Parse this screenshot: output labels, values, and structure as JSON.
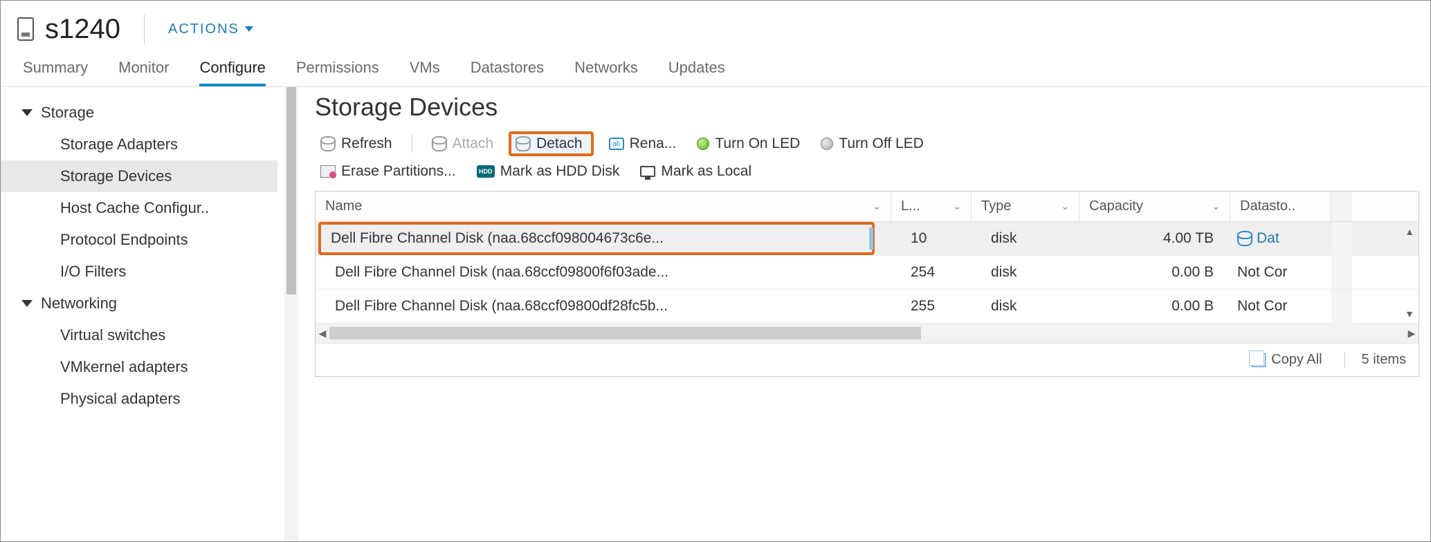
{
  "header": {
    "host_name": "s1240",
    "actions_label": "ACTIONS"
  },
  "tabs": [
    {
      "label": "Summary",
      "active": false
    },
    {
      "label": "Monitor",
      "active": false
    },
    {
      "label": "Configure",
      "active": true
    },
    {
      "label": "Permissions",
      "active": false
    },
    {
      "label": "VMs",
      "active": false
    },
    {
      "label": "Datastores",
      "active": false
    },
    {
      "label": "Networks",
      "active": false
    },
    {
      "label": "Updates",
      "active": false
    }
  ],
  "sidebar": {
    "groups": [
      {
        "label": "Storage",
        "children": [
          {
            "label": "Storage Adapters",
            "selected": false
          },
          {
            "label": "Storage Devices",
            "selected": true
          },
          {
            "label": "Host Cache Configur..",
            "selected": false
          },
          {
            "label": "Protocol Endpoints",
            "selected": false
          },
          {
            "label": "I/O Filters",
            "selected": false
          }
        ]
      },
      {
        "label": "Networking",
        "children": [
          {
            "label": "Virtual switches",
            "selected": false
          },
          {
            "label": "VMkernel adapters",
            "selected": false
          },
          {
            "label": "Physical adapters",
            "selected": false
          }
        ]
      }
    ]
  },
  "panel": {
    "title": "Storage Devices",
    "toolbar": {
      "refresh": "Refresh",
      "attach": "Attach",
      "detach": "Detach",
      "rename": "Rena...",
      "turn_on_led": "Turn On LED",
      "turn_off_led": "Turn Off LED",
      "erase": "Erase Partitions...",
      "mark_hdd": "Mark as HDD Disk",
      "mark_local": "Mark as Local"
    },
    "columns": {
      "name": "Name",
      "l": "L...",
      "type": "Type",
      "capacity": "Capacity",
      "datastore": "Datasto.."
    },
    "rows": [
      {
        "name": "Dell Fibre Channel Disk (naa.68ccf098004673c6e...",
        "l": "10",
        "type": "disk",
        "capacity": "4.00 TB",
        "datastore": "Dat",
        "selected": true,
        "ds_link": true
      },
      {
        "name": "Dell Fibre Channel Disk (naa.68ccf09800f6f03ade...",
        "l": "254",
        "type": "disk",
        "capacity": "0.00 B",
        "datastore": "Not Cor",
        "selected": false,
        "ds_link": false
      },
      {
        "name": "Dell Fibre Channel Disk (naa.68ccf09800df28fc5b...",
        "l": "255",
        "type": "disk",
        "capacity": "0.00 B",
        "datastore": "Not Cor",
        "selected": false,
        "ds_link": false
      }
    ],
    "footer": {
      "copy_all": "Copy All",
      "count": "5 items"
    }
  }
}
